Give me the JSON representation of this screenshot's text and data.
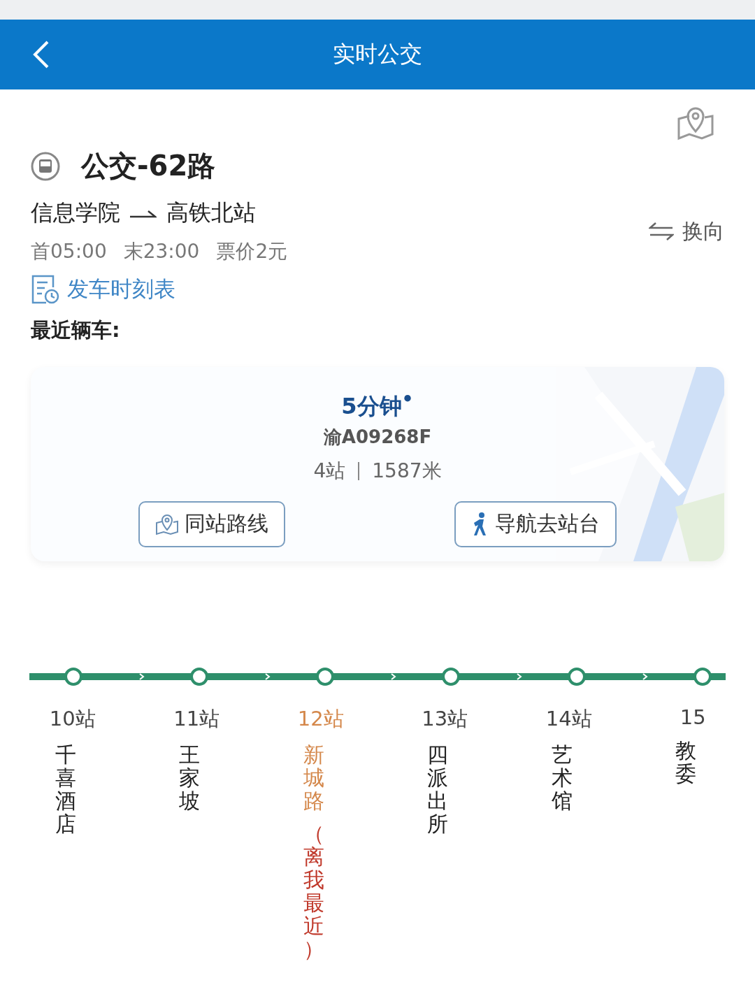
{
  "header": {
    "title": "实时公交"
  },
  "route": {
    "name": "公交-62路",
    "from": "信息学院",
    "to": "高铁北站",
    "reverse": "换向",
    "first": "首05:00",
    "last": "末23:00",
    "fare": "票价2元",
    "timetable": "发车时刻表"
  },
  "nearest": {
    "label": "最近辆车:",
    "eta": "5分钟",
    "eta_mark": "$^{•}$",
    "plate": "渝A09268F",
    "stops": "4站",
    "distance": "1587米",
    "buttons": [
      "同站路线",
      "导航去站台"
    ]
  },
  "stations": [
    {
      "number": "10站",
      "name": "千喜酒店",
      "selected": false
    },
    {
      "number": "11站",
      "name": "王家坡",
      "selected": false
    },
    {
      "number": "12站",
      "name": "新城路",
      "selected": true,
      "note": "（离我最近）"
    },
    {
      "number": "13站",
      "name": "四派出所",
      "selected": false
    },
    {
      "number": "14站",
      "name": "艺术馆",
      "selected": false
    },
    {
      "number": "15",
      "name": "教委",
      "selected": false
    }
  ]
}
